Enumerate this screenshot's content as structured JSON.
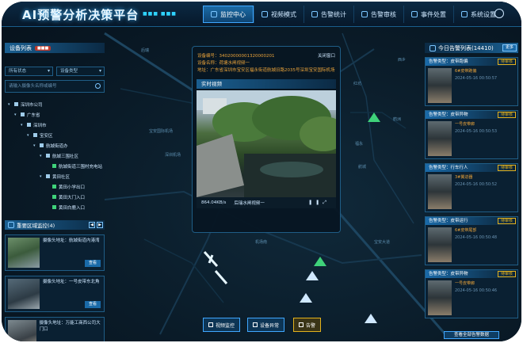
{
  "app": {
    "title": "AI预警分析决策平台"
  },
  "nav": [
    {
      "label": "监控中心",
      "icon": "monitor-icon",
      "active": true
    },
    {
      "label": "视频模式",
      "icon": "video-icon"
    },
    {
      "label": "告警统计",
      "icon": "chart-icon"
    },
    {
      "label": "告警审核",
      "icon": "review-icon"
    },
    {
      "label": "事件处置",
      "icon": "event-icon"
    },
    {
      "label": "系统设置",
      "icon": "settings-icon"
    }
  ],
  "left": {
    "device_list_title": "设备列表",
    "device_badge": "■■■",
    "status_select": "所有状态",
    "type_select": "设备类型",
    "search_placeholder": "请输入摄像头名称或编号",
    "tree": [
      {
        "label": "深圳市公司",
        "depth": 0
      },
      {
        "label": "广东省",
        "depth": 1
      },
      {
        "label": "深圳市",
        "depth": 2
      },
      {
        "label": "宝安区",
        "depth": 3
      },
      {
        "label": "航城街道办",
        "depth": 4
      },
      {
        "label": "航城三围社区",
        "depth": 5
      },
      {
        "label": "航城街道三围村充电站",
        "depth": 6,
        "camera": true
      },
      {
        "label": "黄田社区",
        "depth": 5
      },
      {
        "label": "黄田小学出口",
        "depth": 6,
        "camera": true
      },
      {
        "label": "黄田大门入口",
        "depth": 6,
        "camera": true
      },
      {
        "label": "黄田白鹿入口",
        "depth": 6,
        "camera": true
      }
    ],
    "focus_title": "重要区域监控(4)",
    "focus_items": [
      {
        "text": "摄像头地址：航城街道内港湾",
        "button": "查看"
      },
      {
        "text": "摄像头地址：一号皮带东北角",
        "button": "查看"
      },
      {
        "text": "摄像头地址：万能工商西公司大门口",
        "button": "查看"
      }
    ]
  },
  "popup": {
    "device_code": "设备编号：34020000001320000201",
    "device_name": "设备名称：荷塘水闸视频一",
    "address": "地址：广东省深圳市宝安区福永街道航城旧路2035号深圳宝安国际机场",
    "close_label": "关闭窗口",
    "video_title": "实时视频",
    "bitrate": "864.04KB/s",
    "caption": "后瑞水闸视频一"
  },
  "right": {
    "title": "今日告警列表(14410)",
    "more_label": "更多",
    "alerts": [
      {
        "type": "告警类型：皮带跑偏",
        "status": "待审核",
        "location": "6#皮带跑偏",
        "time": "2024-05-16 00:50:57"
      },
      {
        "type": "告警类型：皮带异物",
        "status": "待审核",
        "location": "一号皮带廊",
        "time": "2024-05-16 00:50:53"
      },
      {
        "type": "告警类型：行车行人",
        "status": "待审核",
        "location": "3#翼进器",
        "time": "2024-05-16 00:50:52"
      },
      {
        "type": "告警类型：皮带运行",
        "status": "待审核",
        "location": "6#皮带尾部",
        "time": "2024-05-16 00:50:48"
      },
      {
        "type": "告警类型：皮带异物",
        "status": "待审核",
        "location": "一号皮带廊",
        "time": "2024-05-16 00:50:46"
      }
    ],
    "view_all": "查看全部告警数据"
  },
  "bottom": {
    "buttons": [
      {
        "label": "视频监控",
        "warn": false
      },
      {
        "label": "设备异常",
        "warn": false
      },
      {
        "label": "告警",
        "warn": true
      }
    ]
  },
  "map_labels": [
    "后瑞",
    "宝安国际机场",
    "深圳机场",
    "红坊",
    "西乡",
    "福永",
    "航城",
    "鹤洲",
    "宝安大道",
    "机场南"
  ]
}
